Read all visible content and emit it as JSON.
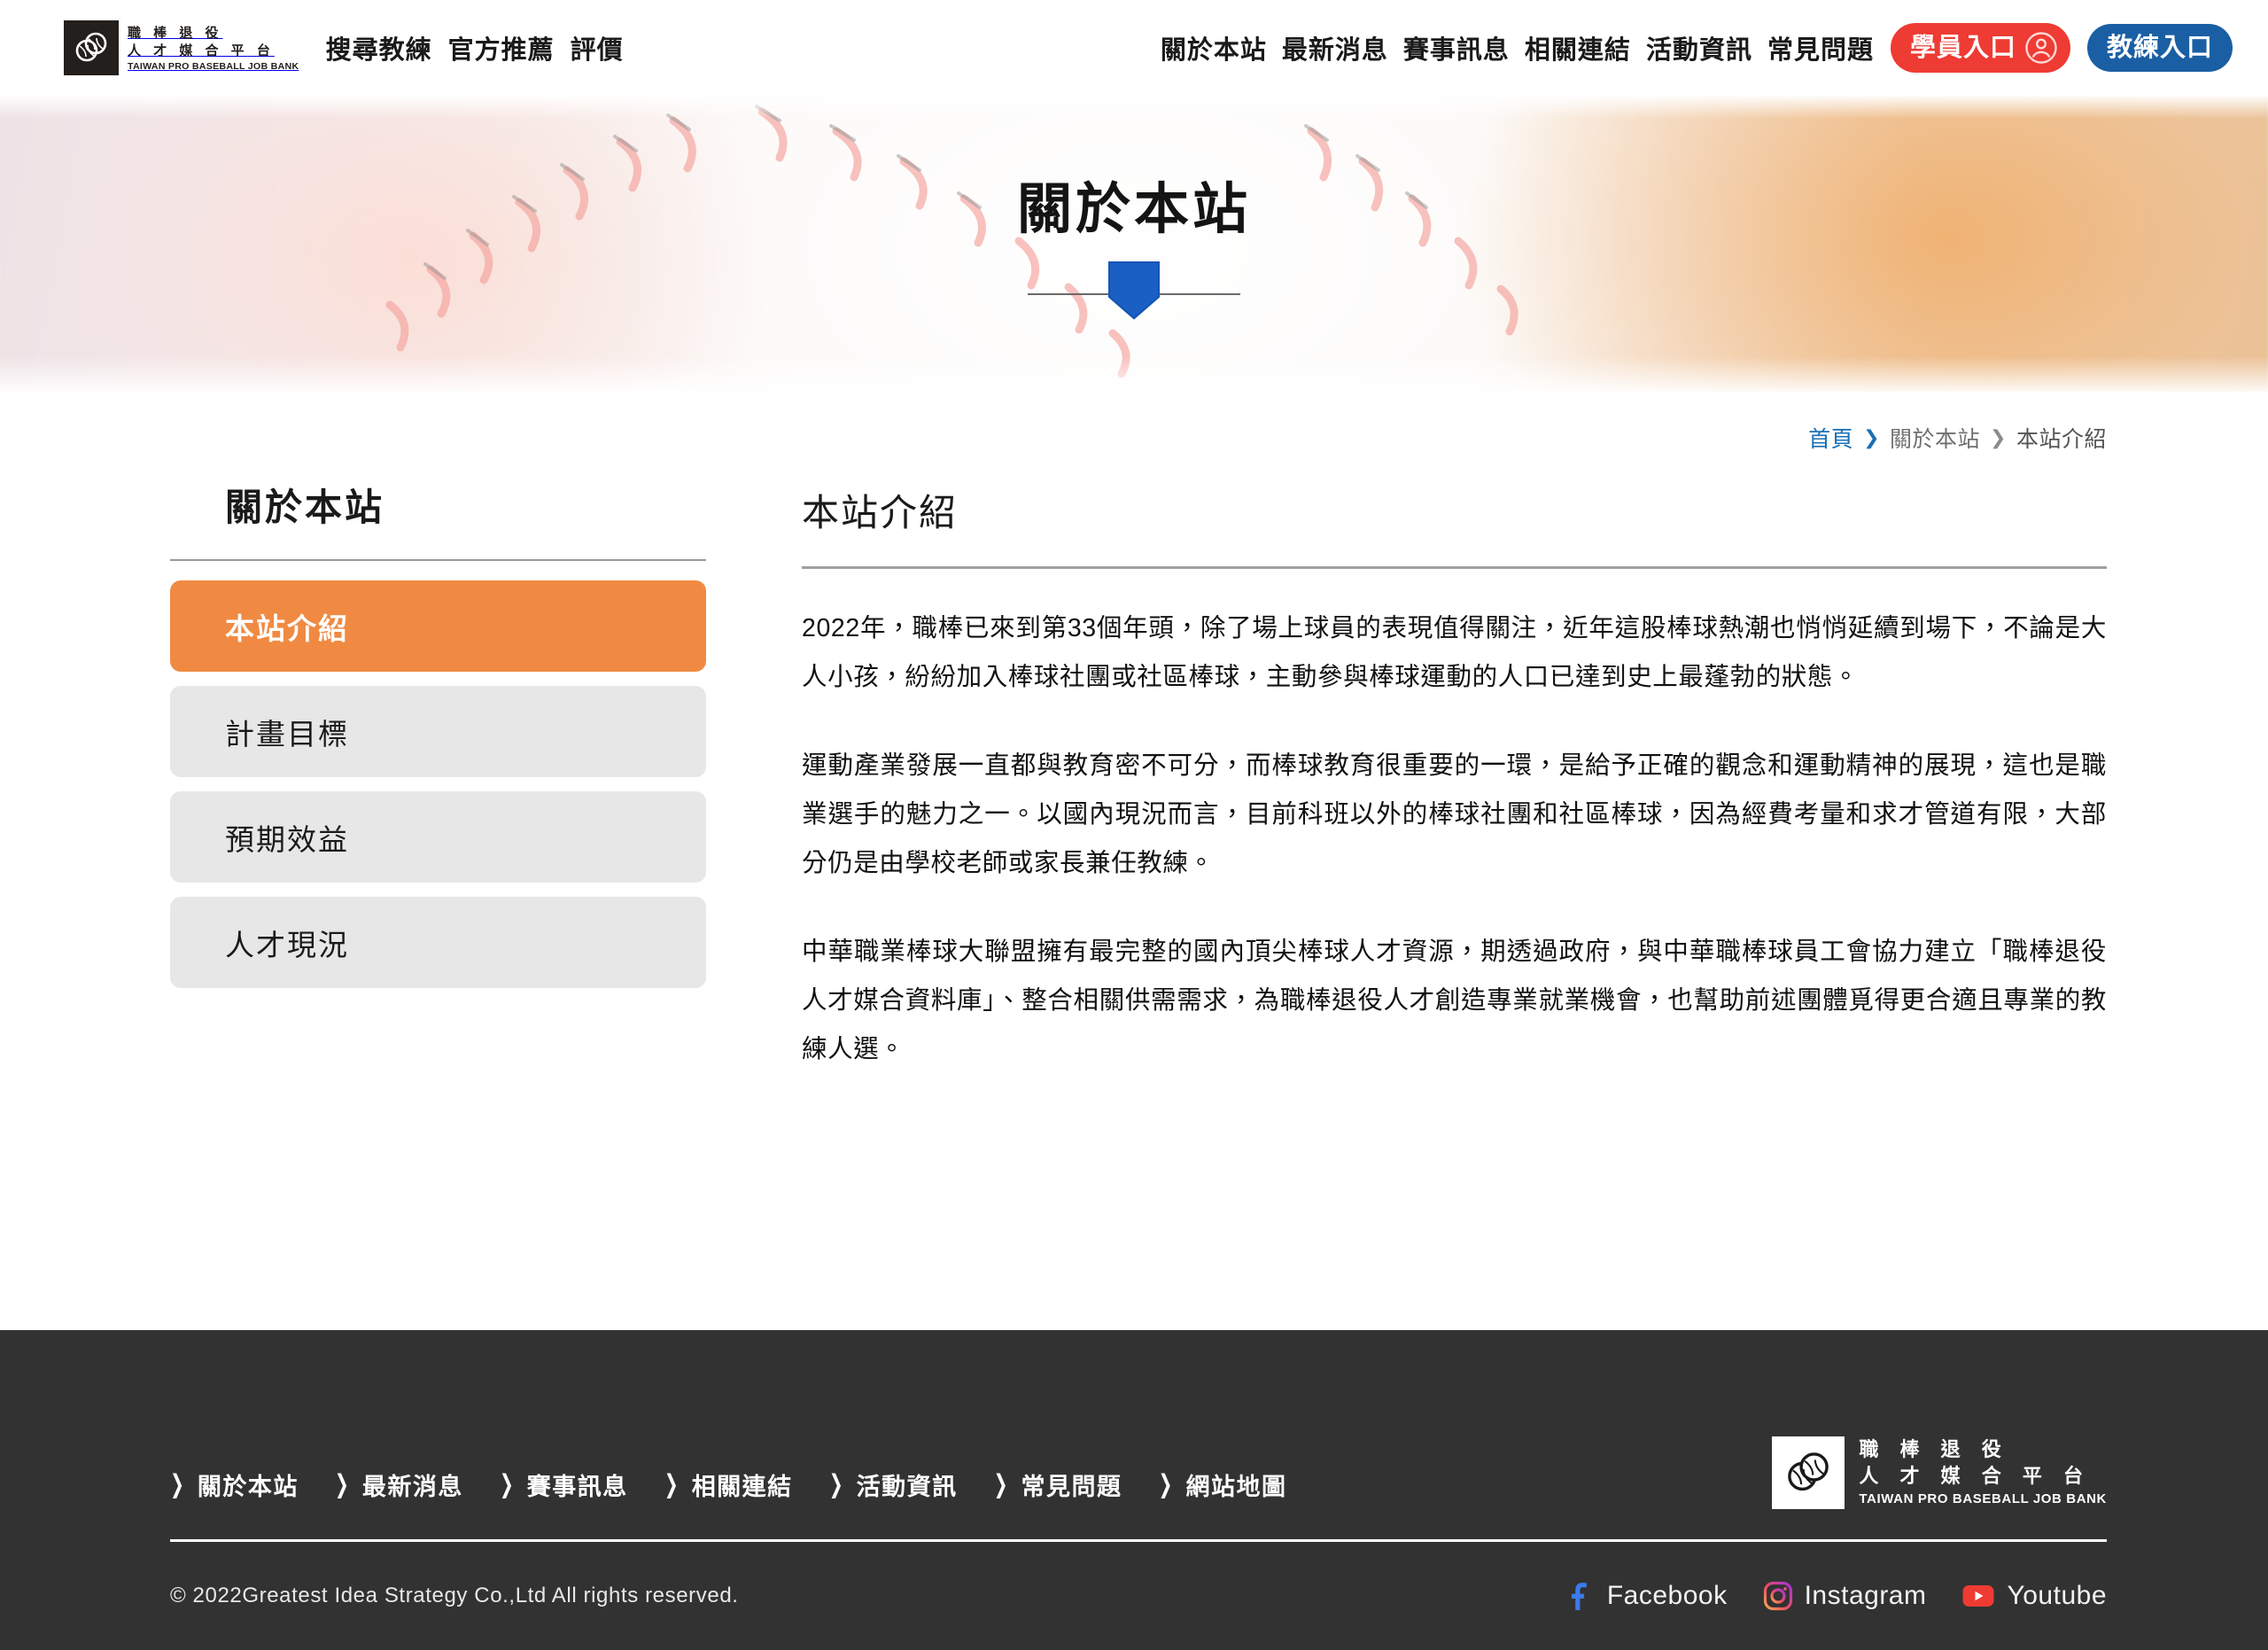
{
  "header": {
    "logo": {
      "cn_line1": "職 棒 退 役",
      "cn_line2": "人 才 媒 合 平 台",
      "en": "TAIWAN PRO BASEBALL JOB BANK"
    },
    "primary_nav": [
      "搜尋教練",
      "官方推薦",
      "評價"
    ],
    "util_nav": [
      "關於本站",
      "最新消息",
      "賽事訊息",
      "相關連結",
      "活動資訊",
      "常見問題"
    ],
    "student_portal": "學員入口",
    "coach_portal": "教練入口",
    "colors": {
      "student_red": "#EE3B33",
      "coach_blue": "#1A5FA4"
    }
  },
  "hero": {
    "title": "關於本站",
    "plate_color": "#1455B5"
  },
  "breadcrumb": {
    "home": "首頁",
    "sep": "❯",
    "section": "關於本站",
    "current": "本站介紹",
    "link_color": "#1A6FB5"
  },
  "sidebar": {
    "title": "關於本站",
    "items": [
      {
        "label": "本站介紹",
        "active": true
      },
      {
        "label": "計畫目標",
        "active": false
      },
      {
        "label": "預期效益",
        "active": false
      },
      {
        "label": "人才現況",
        "active": false
      }
    ],
    "active_color": "#F08A42"
  },
  "main": {
    "title": "本站介紹",
    "paragraphs": [
      "2022年，職棒已來到第33個年頭，除了場上球員的表現值得關注，近年這股棒球熱潮也悄悄延續到場下，不論是大人小孩，紛紛加入棒球社團或社區棒球，主動參與棒球運動的人口已達到史上最蓬勃的狀態。",
      "運動產業發展一直都與教育密不可分，而棒球教育很重要的一環，是給予正確的觀念和運動精神的展現，這也是職業選手的魅力之一。以國內現況而言，目前科班以外的棒球社團和社區棒球，因為經費考量和求才管道有限，大部分仍是由學校老師或家長兼任教練。",
      "中華職業棒球大聯盟擁有最完整的國內頂尖棒球人才資源，期透過政府，與中華職棒球員工會協力建立「職棒退役人才媒合資料庫」、整合相關供需需求，為職棒退役人才創造專業就業機會，也幫助前述團體覓得更合適且專業的教練人選。"
    ]
  },
  "footer": {
    "nav": [
      "關於本站",
      "最新消息",
      "賽事訊息",
      "相關連結",
      "活動資訊",
      "常見問題",
      "網站地圖"
    ],
    "arrow": "❯",
    "logo": {
      "cn_line1": "職 棒 退 役",
      "cn_line2": "人 才 媒 合 平 台",
      "en": "TAIWAN PRO BASEBALL JOB BANK"
    },
    "copyright": "© 2022Greatest Idea Strategy Co.,Ltd All rights reserved.",
    "social": [
      {
        "label": "Facebook",
        "icon": "facebook-icon",
        "color": "#3B7BEA"
      },
      {
        "label": "Instagram",
        "icon": "instagram-icon",
        "color": "#D6249F"
      },
      {
        "label": "Youtube",
        "icon": "youtube-icon",
        "color": "#EE3B33"
      }
    ],
    "background": "#323232"
  }
}
